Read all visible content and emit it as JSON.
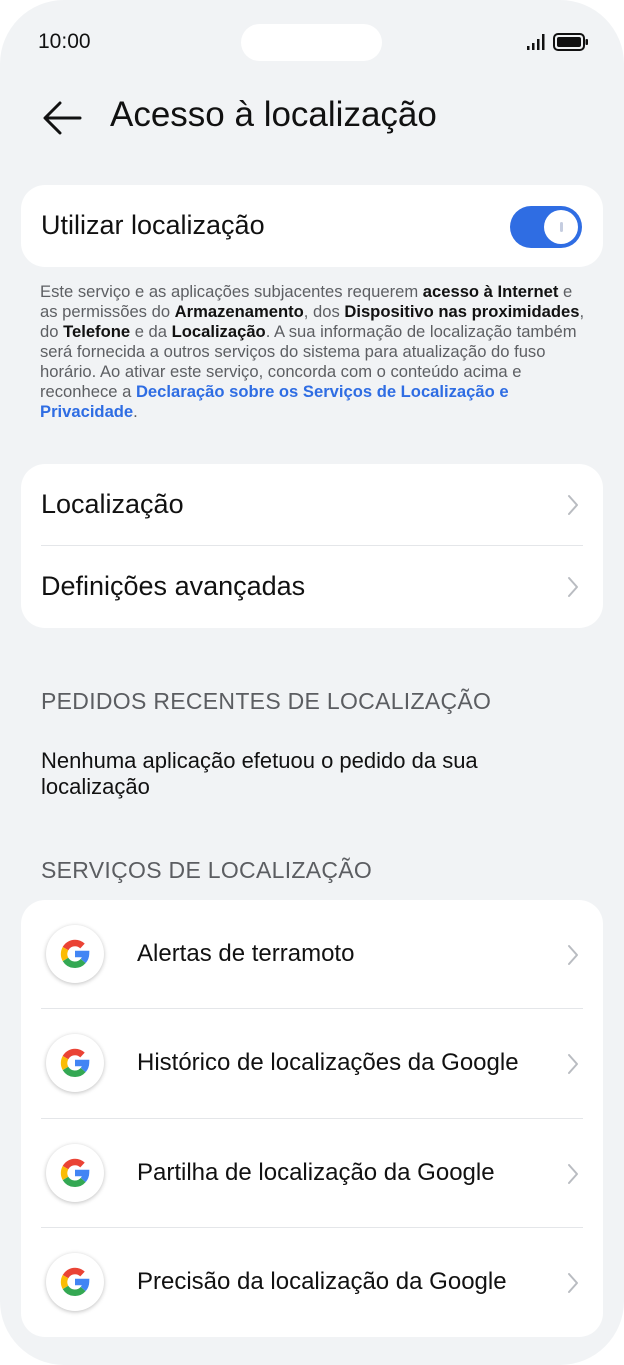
{
  "status_bar": {
    "time": "10:00"
  },
  "header": {
    "title": "Acesso à localização"
  },
  "use_location": {
    "label": "Utilizar localização",
    "enabled": true
  },
  "description": {
    "p1": "Este serviço e as aplicações subjacentes requerem ",
    "b1": "acesso à Internet",
    "p2": " e as permissões do ",
    "b2": "Armazenamento",
    "p3": ", dos ",
    "b3": "Dispositivo nas proximidades",
    "p4": ", do ",
    "b4": "Telefone",
    "p5": " e da ",
    "b5": "Localização",
    "p6": ". A sua informação de localização também será fornecida a outros serviços do sistema para atualização do fuso horário. Ao ativar este serviço, concorda com o conteúdo acima e reconhece a ",
    "link": "Declaração sobre os Serviços de Localização e Privacidade",
    "p7": "."
  },
  "settings": {
    "items": [
      {
        "label": "Localização"
      },
      {
        "label": "Definições avançadas"
      }
    ]
  },
  "recent_requests": {
    "heading": "PEDIDOS RECENTES DE LOCALIZAÇÃO",
    "empty_text": "Nenhuma aplicação efetuou o pedido da sua localização"
  },
  "location_services": {
    "heading": "SERVIÇOS DE LOCALIZAÇÃO",
    "items": [
      {
        "label": "Alertas de terramoto",
        "icon": "google-icon"
      },
      {
        "label": "Histórico de localizações da Google",
        "icon": "google-icon"
      },
      {
        "label": "Partilha de localização da Google",
        "icon": "google-icon"
      },
      {
        "label": "Precisão da localização da Google",
        "icon": "google-icon"
      }
    ]
  },
  "colors": {
    "accent": "#2f6de3",
    "background": "#f1f3f5",
    "card": "#ffffff"
  }
}
